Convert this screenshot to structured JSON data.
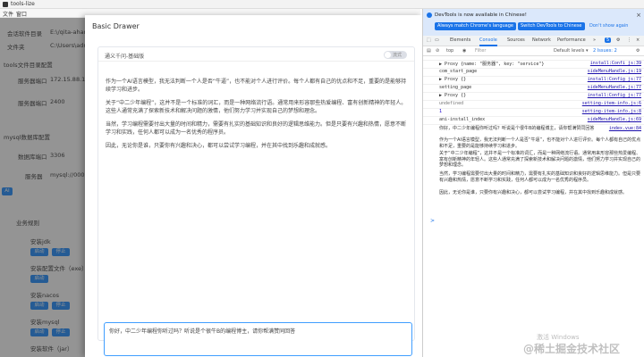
{
  "window": {
    "title": "tools-lize",
    "menu": [
      "文件",
      "窗口"
    ]
  },
  "sidebar": {
    "lines": [
      {
        "label": "会话软件目录",
        "value": "E:\\/qita-ahan"
      },
      {
        "label": "文件夹",
        "value": "C:\\Users\\admin"
      },
      {
        "label": "tools文件目录配置",
        "value": ""
      },
      {
        "label": "服务器端口",
        "value": "172.15.88.1"
      },
      {
        "label": "服务器端口",
        "value": "2400"
      },
      {
        "label": "mysql数据库配置",
        "value": ""
      },
      {
        "label": "数据库端口",
        "value": "3306"
      },
      {
        "label": "服务器",
        "value": "mysql://000"
      },
      {
        "label": "AI",
        "value": ""
      },
      {
        "label": "业务规则",
        "value": ""
      },
      {
        "label": "安装jdk",
        "value": ""
      },
      {
        "label": "安装配置文件（exe）",
        "value": ""
      },
      {
        "label": "安装nacos",
        "value": ""
      },
      {
        "label": "安装mysql",
        "value": ""
      },
      {
        "label": "安装软件（jar）",
        "value": ""
      }
    ],
    "buttons": [
      "启动",
      "停止"
    ]
  },
  "drawer": {
    "title": "Basic Drawer",
    "card_title": "通义千问-基础版",
    "toggle_label": "流式",
    "paragraphs": [
      "作为一个AI语言模型，我无法判断一个人是否“牛逼”，也不能对个人进行评价。每个人都有自己的优点和不足，重要的是能够持续学习和进步。",
      "关于“中二少年编程”，这并不是一个标准的词汇，而是一种网络流行语。通常用来形容那些热爱编程、富有创新精神的年轻人。这些人通常充满了探索新技术和解决问题的激情，他们努力学习并实现自己的梦想和理念。",
      "当然，学习编程需要付出大量的时间和精力，需要有扎实的基础知识和良好的逻辑思维能力。但是只要有兴趣和热情，愿意不断学习和实践，任何人都可以成为一名优秀的程序员。",
      "因此，无论你是谁，只要你有兴趣和决心，都可以尝试学习编程，并在其中找到乐趣和成就感。"
    ],
    "input_value": "你好，中二少年编程你听过吗？听说是个很牛B的编程博主，请你帮满赞同回答"
  },
  "devtools": {
    "banner": "DevTools is now available in Chinese!",
    "btn_match": "Always match Chrome's language",
    "btn_switch": "Switch DevTools to Chinese",
    "btn_dont": "Don't show again",
    "tabs": [
      "Elements",
      "Console",
      "Sources",
      "Network",
      "Performance",
      "»"
    ],
    "badge": "5",
    "toolbar": {
      "top": "top",
      "filter": "Filter",
      "levels": "Default levels ▾",
      "issues": "2 Issues: 2"
    },
    "rows": [
      {
        "m": "▶ Proxy {name: \"服务器\", key: \"service\"}",
        "s": "install:Confi_js:39"
      },
      {
        "m": "com_start_page",
        "s": "sideMenuHandle.js:19"
      },
      {
        "m": "▶ Proxy {}",
        "s": "install:Config_js:77"
      },
      {
        "m": "setting_page",
        "s": "sideMenuHandle.js:77"
      },
      {
        "m": "▶ Proxy {}",
        "s": "install:Config_js:77"
      },
      {
        "m": "undefined",
        "s": "setting-item-info.js:6"
      },
      {
        "m": "1",
        "s": "setting-item-info.js:8"
      },
      {
        "m": "ani-install_index",
        "s": "sideMenuHandle.js:69"
      }
    ],
    "log_paras": [
      "你好，中二少年编程你听过吗？听说是个很牛B的编程博主，请你帮满赞同回答",
      "作为一个AI语言模型，我无法判断一个人是否“牛逼”，也不能对个人进行评价。每个人都有自己的优点和不足，重要的是能够持续学习和进步。",
      "关于“中二少年编程”，这并不是一个标准的词汇，而是一种网络流行语。通常用来形容那些热爱编程、富有创新精神的年轻人。这些人通常充满了探索新技术和解决问题的激情，他们努力学习并实现自己的梦想和理念。",
      "当然，学习编程需要付出大量的时间和精力，需要有扎实的基础知识和良好的逻辑思维能力。但是只要有兴趣和热情，愿意不断学习和实践，任何人都可以成为一名优秀的程序员。",
      "因此，无论你是谁，只要你有兴趣和决心，都可以尝试学习编程，并在其中找到乐趣和成就感。"
    ],
    "log_para_source": "index.vue:84",
    "prompt": ">"
  },
  "watermark": {
    "line1": "激活 Windows",
    "line2": "@稀土掘金技术社区"
  },
  "colors": {
    "accent": "#409eff",
    "devtools_blue": "#1a73e8",
    "banner_bg": "#dbe8fb"
  }
}
